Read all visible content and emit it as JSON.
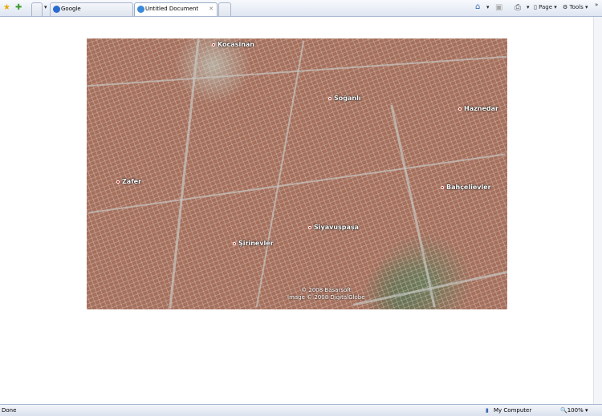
{
  "toolbar": {
    "tabs": [
      {
        "label": "Google"
      },
      {
        "label": "Untitled Document"
      }
    ],
    "page_label": "Page",
    "tools_label": "Tools",
    "chevron": "»"
  },
  "map": {
    "places": [
      "Kocasinan",
      "Soğanlı",
      "Haznedar",
      "Zafer",
      "Bahçelievler",
      "Siyavuşpaşa",
      "Şirinevler"
    ],
    "copyright": [
      "© 2008 Basarsoft",
      "Image © 2008 DigitalGlobe"
    ]
  },
  "status": {
    "text": "Done",
    "zone": "My Computer",
    "zoom": "100%"
  }
}
